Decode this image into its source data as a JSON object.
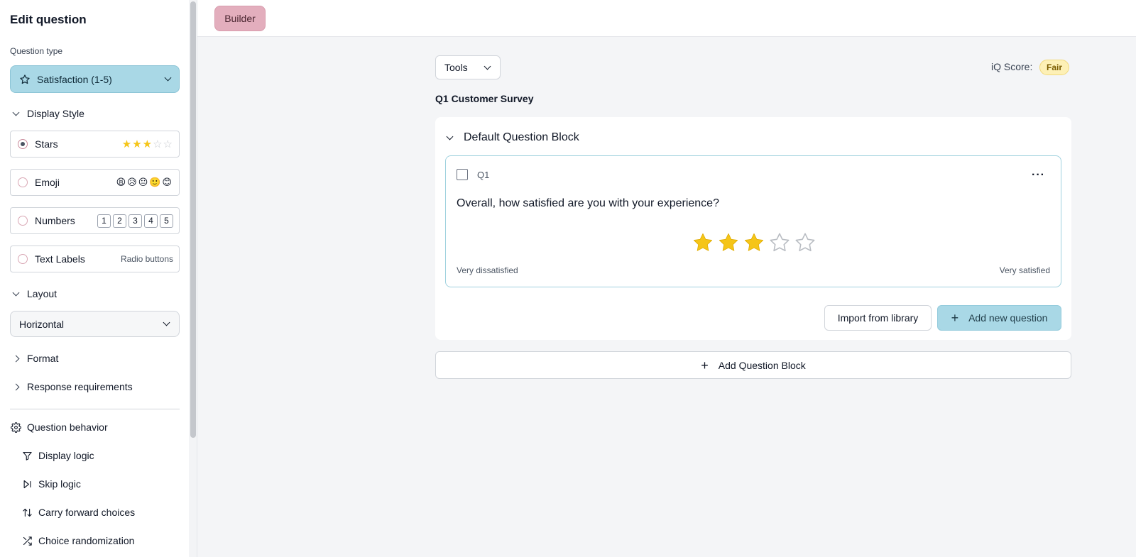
{
  "sidebar": {
    "title": "Edit question",
    "question_type_label": "Question type",
    "question_type_value": "Satisfaction (1-5)",
    "display_style": {
      "heading": "Display Style",
      "options": [
        {
          "label": "Stars",
          "selected": true,
          "preview": "stars",
          "filled": 3,
          "total": 5
        },
        {
          "label": "Emoji",
          "selected": false,
          "preview": "😫😥😐🙂😊"
        },
        {
          "label": "Numbers",
          "selected": false,
          "preview_numbers": [
            "1",
            "2",
            "3",
            "4",
            "5"
          ]
        },
        {
          "label": "Text Labels",
          "selected": false,
          "preview_text": "Radio buttons"
        }
      ]
    },
    "layout": {
      "heading": "Layout",
      "value": "Horizontal"
    },
    "format": {
      "heading": "Format"
    },
    "response_requirements": {
      "heading": "Response requirements"
    },
    "question_behavior": {
      "heading": "Question behavior",
      "items": [
        {
          "label": "Display logic",
          "icon": "filter-icon"
        },
        {
          "label": "Skip logic",
          "icon": "skip-icon"
        },
        {
          "label": "Carry forward choices",
          "icon": "arrows-updown-icon"
        },
        {
          "label": "Choice randomization",
          "icon": "shuffle-icon"
        }
      ]
    }
  },
  "topbar": {
    "builder_label": "Builder"
  },
  "main": {
    "tools_label": "Tools",
    "iq_score_label": "iQ Score:",
    "iq_score_value": "Fair",
    "survey_title": "Q1 Customer Survey",
    "block": {
      "title": "Default Question Block",
      "question": {
        "number": "Q1",
        "text": "Overall, how satisfied are you with your experience?",
        "rating_filled": 3,
        "rating_total": 5,
        "min_label": "Very dissatisfied",
        "max_label": "Very satisfied"
      },
      "import_label": "Import from library",
      "add_question_label": "Add new question"
    },
    "add_block_label": "Add Question Block"
  },
  "colors": {
    "accent_blue": "#a9d8e6",
    "builder_pink": "#e3aebd",
    "star_gold": "#f5c518",
    "badge_yellow": "#fdf0b6"
  }
}
